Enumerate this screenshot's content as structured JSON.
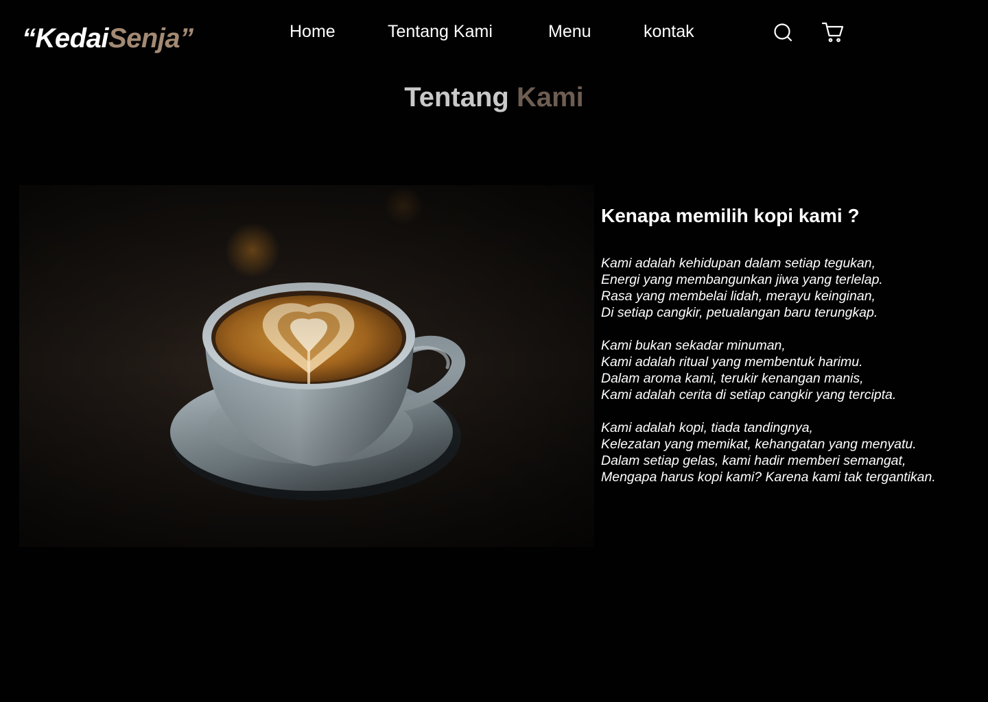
{
  "brand": {
    "part1": "“Kedai",
    "part2": "Senja”"
  },
  "nav": {
    "links": [
      {
        "label": "Home"
      },
      {
        "label": "Tentang Kami"
      },
      {
        "label": "Menu"
      },
      {
        "label": "kontak"
      }
    ],
    "icons": [
      "search-icon",
      "cart-icon"
    ]
  },
  "section": {
    "title_part1": "Tentang",
    "title_part2": "Kami"
  },
  "about": {
    "image_subject": "cup of latte with heart latte art on a saucer",
    "heading": "Kenapa memilih kopi kami ?",
    "stanzas": [
      [
        "Kami adalah kehidupan dalam setiap tegukan,",
        "Energi yang membangunkan jiwa yang terlelap.",
        "Rasa yang membelai lidah, merayu keinginan,",
        "Di setiap cangkir, petualangan baru terungkap."
      ],
      [
        "Kami bukan sekadar minuman,",
        "Kami adalah ritual yang membentuk harimu.",
        "Dalam aroma kami, terukir kenangan manis,",
        "Kami adalah cerita di setiap cangkir yang tercipta."
      ],
      [
        "Kami adalah kopi, tiada tandingnya,",
        "Kelezatan yang memikat, kehangatan yang menyatu.",
        "Dalam setiap gelas, kami hadir memberi semangat,",
        "Mengapa harus kopi kami? Karena kami tak tergantikan."
      ]
    ]
  },
  "colors": {
    "background": "#010101",
    "text": "#ffffff",
    "accent_brown": "#a38a74",
    "title_grey": "#c9c9c9",
    "title_brown": "#6e5d52"
  }
}
